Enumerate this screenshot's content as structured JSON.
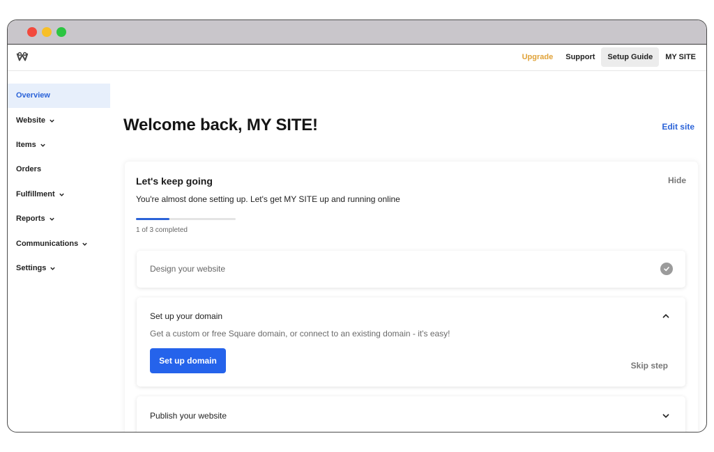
{
  "topnav": {
    "logo_icon": "weebly-w-logo",
    "links": [
      "Upgrade",
      "Support",
      "Setup Guide",
      "MY SITE"
    ],
    "upgrade_color": "#e0a238"
  },
  "sidebar": {
    "items": [
      {
        "label": "Overview",
        "active": true
      },
      {
        "label": "Website",
        "has_chevron": true
      },
      {
        "label": "Items",
        "has_chevron": true
      },
      {
        "label": "Orders"
      },
      {
        "label": "Fulfillment",
        "has_chevron": true
      },
      {
        "label": "Reports",
        "has_chevron": true
      },
      {
        "label": "Communications",
        "has_chevron": true
      },
      {
        "label": "Settings",
        "has_chevron": true
      }
    ]
  },
  "main": {
    "welcome": "Welcome back, MY SITE!",
    "edit_site": "Edit site"
  },
  "setup_card": {
    "title": "Let's keep going",
    "hide": "Hide",
    "subtitle": "You're almost done setting up. Let's get MY SITE up and running online",
    "progress_fraction": 0.333,
    "progress_text": "1 of 3 completed",
    "steps": [
      {
        "title": "Design your website",
        "state": "completed",
        "icon": "check-circle-icon"
      },
      {
        "title": "Set up your domain",
        "state": "expanded",
        "description": "Get a custom or free Square domain, or connect to an existing domain - it's easy!",
        "button": "Set up domain",
        "skip": "Skip step",
        "icon": "chevron-up-icon"
      },
      {
        "title": "Publish your website",
        "state": "collapsed",
        "icon": "chevron-down-icon"
      }
    ]
  },
  "colors": {
    "accent": "#2563eb",
    "link": "#2b63d8",
    "active_bg": "#e7effb"
  }
}
